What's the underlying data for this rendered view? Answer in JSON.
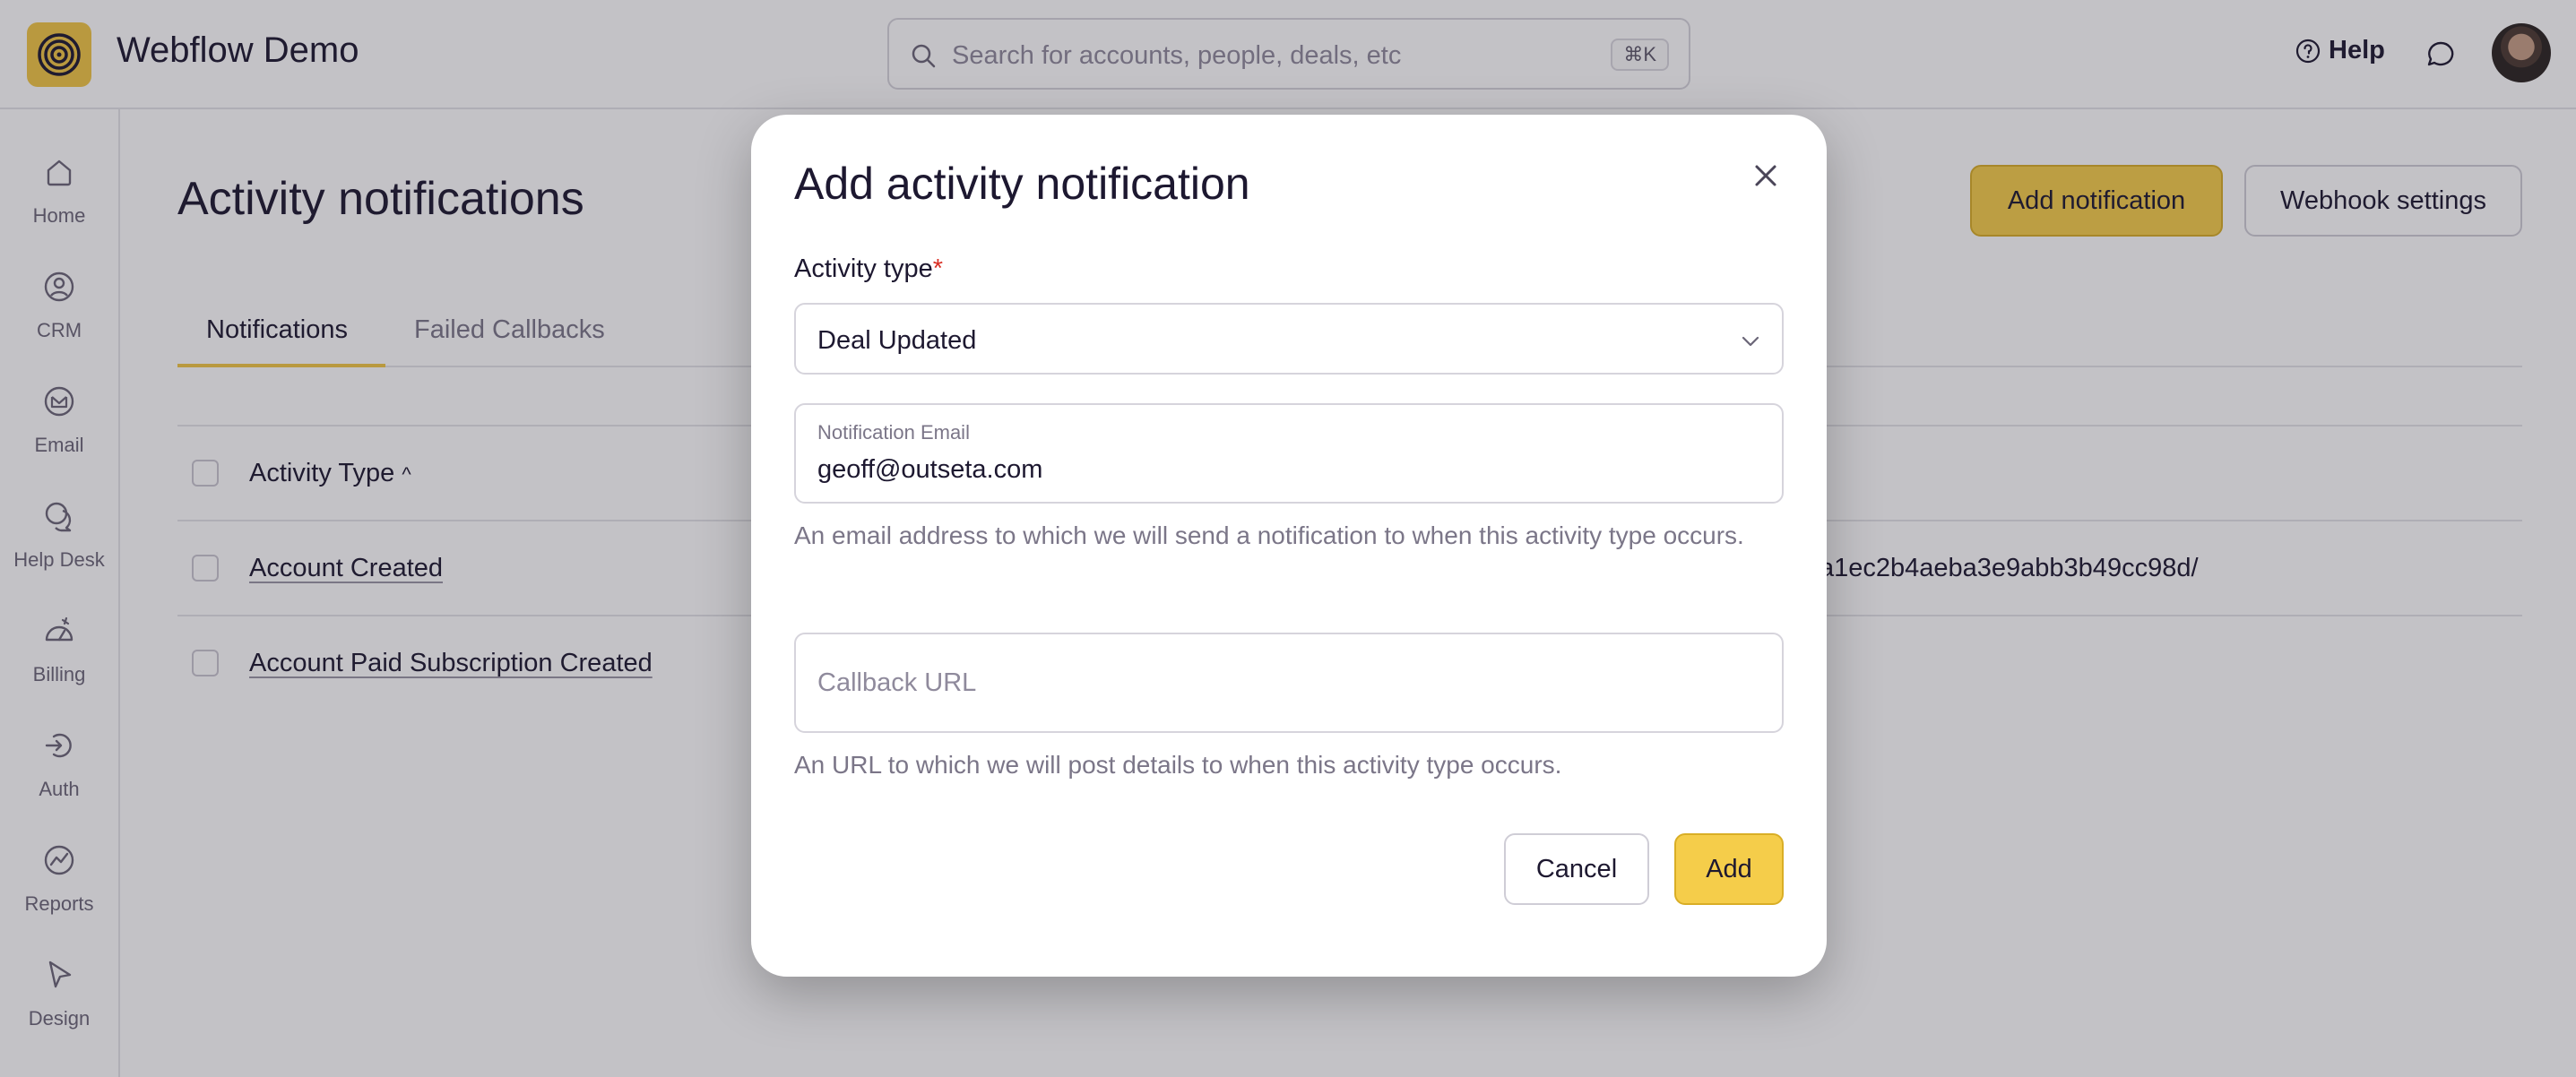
{
  "header": {
    "app_title": "Webflow Demo",
    "search_placeholder": "Search for accounts, people, deals, etc",
    "search_shortcut": "⌘K",
    "help_label": "Help",
    "accent_color": "#f1c745"
  },
  "sidebar": {
    "items": [
      {
        "label": "Home",
        "icon": "home-icon"
      },
      {
        "label": "CRM",
        "icon": "crm-icon"
      },
      {
        "label": "Email",
        "icon": "email-icon"
      },
      {
        "label": "Help Desk",
        "icon": "help-desk-icon"
      },
      {
        "label": "Billing",
        "icon": "billing-icon"
      },
      {
        "label": "Auth",
        "icon": "auth-icon"
      },
      {
        "label": "Reports",
        "icon": "reports-icon"
      },
      {
        "label": "Design",
        "icon": "design-icon"
      }
    ]
  },
  "page": {
    "title": "Activity notifications",
    "add_button": "Add notification",
    "webhook_button": "Webhook settings",
    "tabs": [
      "Notifications",
      "Failed Callbacks"
    ],
    "table": {
      "header": "Activity Type",
      "sort_indicator": "^",
      "rows": [
        {
          "activity": "Account Created",
          "callback_fragment": "a1ec2b4aeba3e9abb3b49cc98d/"
        },
        {
          "activity": "Account Paid Subscription Created",
          "callback_fragment": ""
        }
      ]
    }
  },
  "modal": {
    "title": "Add activity notification",
    "activity_type_label": "Activity type",
    "required_marker": "*",
    "activity_type_value": "Deal Updated",
    "email_label": "Notification Email",
    "email_value": "geoff@outseta.com",
    "email_hint": "An email address to which we will send a notification to when this activity type occurs.",
    "callback_placeholder": "Callback URL",
    "callback_hint": "An URL to which we will post details to when this activity type occurs.",
    "cancel_label": "Cancel",
    "add_label": "Add"
  }
}
